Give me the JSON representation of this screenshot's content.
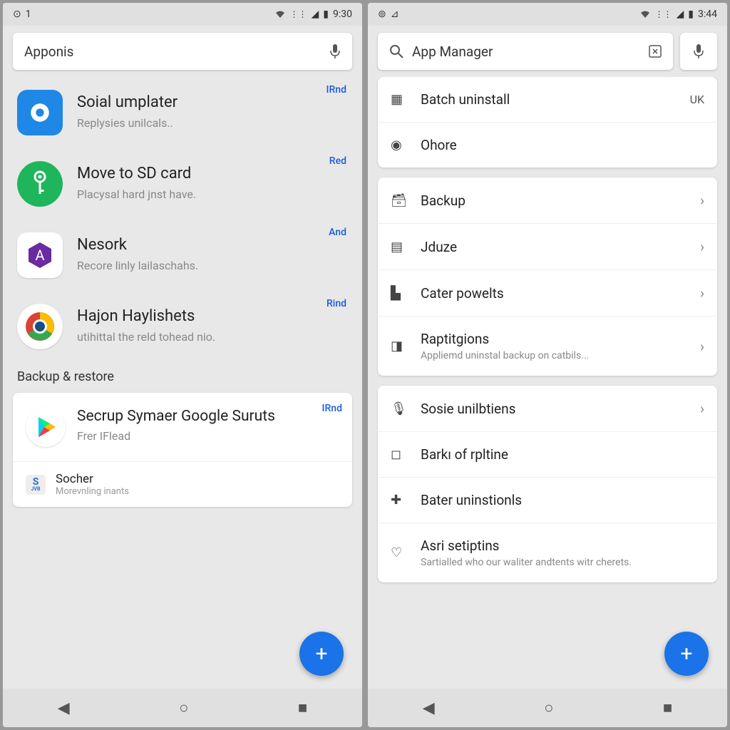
{
  "phoneA": {
    "status": {
      "leftIcon": "⊙",
      "leftText": "1",
      "wifi": "⊚",
      "signal": "◢",
      "batt": "▮",
      "time": "9:30"
    },
    "search": {
      "value": "Apponis"
    },
    "apps": [
      {
        "title": "Soial umplater",
        "sub": "Replysies unilcals..",
        "tag": "IRnd"
      },
      {
        "title": "Move to SD card",
        "sub": "Placysal hard jnst have.",
        "tag": "Red"
      },
      {
        "title": "Nesork",
        "sub": "Recore linly lailaschahs.",
        "tag": "And"
      },
      {
        "title": "Hajon Haylishets",
        "sub": "utihittal the reld tohead nio.",
        "tag": "Rind"
      }
    ],
    "sectionLabel": "Backup & restore",
    "backup": {
      "title": "Secrup Symaer Google Suruts",
      "sub": "Frer IFlead",
      "tag": "IRnd",
      "row2title": "Socher",
      "row2sub": "Morevnling inants",
      "row2badge": "JVB"
    }
  },
  "phoneB": {
    "status": {
      "leftIcon": "⊚",
      "leftText": "⊿",
      "wifi": "⊚",
      "signal": "◢",
      "batt": "▮",
      "time": "3:44"
    },
    "search": {
      "value": "App Manager"
    },
    "group1": [
      {
        "icon": "▦",
        "title": "Batch uninstall",
        "tag": "UK"
      },
      {
        "icon": "◉",
        "title": "Ohore"
      }
    ],
    "group2": [
      {
        "icon": "🗃",
        "title": "Backup",
        "chev": true
      },
      {
        "icon": "▤",
        "title": "Jduze",
        "chev": true
      },
      {
        "icon": "▙",
        "title": "Cater powelts",
        "chev": true
      },
      {
        "icon": "◨",
        "title": "Raptitgions",
        "sub": "Appliemd uninstal backup on catbils...",
        "chev": true
      }
    ],
    "group3": [
      {
        "icon": "🎙",
        "title": "Sosie unilbtiens",
        "chev": true
      },
      {
        "icon": "◻",
        "title": "Barkı of rpltine"
      },
      {
        "icon": "✚",
        "title": "Bater uninstionls"
      },
      {
        "icon": "♡",
        "title": "Asri setiptins",
        "sub": "Sartialled who our waliter andtents witr cherets."
      }
    ]
  },
  "fab": "+",
  "nav": {
    "back": "◀",
    "home": "○",
    "recent": "■"
  }
}
